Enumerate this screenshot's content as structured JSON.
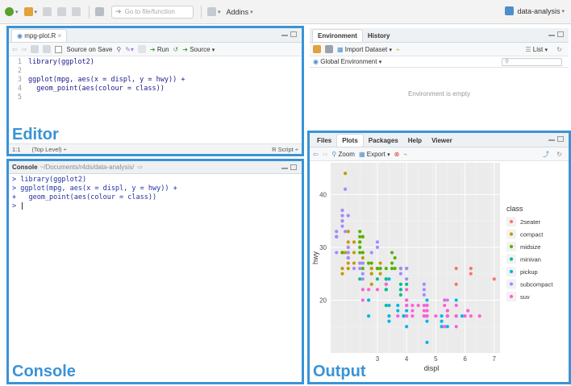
{
  "topbar": {
    "goto_placeholder": "Go to file/function",
    "addins_label": "Addins",
    "project_label": "data-analysis"
  },
  "editor": {
    "tab_label": "mpg-plot.R",
    "source_on_save": "Source on Save",
    "run_label": "Run",
    "source_label": "Source",
    "lines": [
      {
        "n": "1",
        "text": "library(ggplot2)"
      },
      {
        "n": "2",
        "text": ""
      },
      {
        "n": "3",
        "text": "ggplot(mpg, aes(x = displ, y = hwy)) +"
      },
      {
        "n": "4",
        "text": "  geom_point(aes(colour = class))"
      },
      {
        "n": "5",
        "text": ""
      }
    ],
    "status_pos": "1:1",
    "status_scope": "(Top Level) ÷",
    "status_type": "R Script ÷",
    "big_label": "Editor"
  },
  "console": {
    "title": "Console",
    "path": "~/Documents/r4ds/data-analysis/",
    "lines": [
      "> library(ggplot2)",
      "> ggplot(mpg, aes(x = displ, y = hwy)) +",
      "+   geom_point(aes(colour = class))",
      "> "
    ],
    "big_label": "Console"
  },
  "environment": {
    "tabs": [
      "Environment",
      "History"
    ],
    "import_label": "Import Dataset",
    "list_label": "List",
    "scope_label": "Global Environment",
    "empty_text": "Environment is empty"
  },
  "output": {
    "tabs": [
      "Files",
      "Plots",
      "Packages",
      "Help",
      "Viewer"
    ],
    "active_tab": "Plots",
    "zoom_label": "Zoom",
    "export_label": "Export",
    "big_label": "Output"
  },
  "colors": {
    "accent": "#3a93d6",
    "2seater": "#f8766d",
    "compact": "#c49a00",
    "midsize": "#53b400",
    "minivan": "#00c094",
    "pickup": "#00b6eb",
    "subcompact": "#a58aff",
    "suv": "#fb61d7"
  },
  "chart_data": {
    "type": "scatter",
    "title": "",
    "xlabel": "displ",
    "ylabel": "hwy",
    "xlim": [
      1.4,
      7.2
    ],
    "ylim": [
      10,
      46
    ],
    "x_ticks": [
      3,
      4,
      5,
      6,
      7
    ],
    "y_ticks": [
      20,
      30,
      40
    ],
    "grid": true,
    "legend_title": "class",
    "legend_position": "right",
    "series": [
      {
        "name": "2seater",
        "points": [
          [
            5.7,
            26
          ],
          [
            5.7,
            23
          ],
          [
            6.2,
            26
          ],
          [
            6.2,
            25
          ],
          [
            7.0,
            24
          ]
        ]
      },
      {
        "name": "compact",
        "points": [
          [
            1.8,
            29
          ],
          [
            1.8,
            29
          ],
          [
            2.0,
            31
          ],
          [
            2.0,
            30
          ],
          [
            2.8,
            26
          ],
          [
            2.8,
            26
          ],
          [
            3.1,
            27
          ],
          [
            1.8,
            26
          ],
          [
            1.8,
            25
          ],
          [
            2.0,
            28
          ],
          [
            2.0,
            27
          ],
          [
            2.8,
            25
          ],
          [
            2.8,
            25
          ],
          [
            3.1,
            25
          ],
          [
            2.2,
            27
          ],
          [
            2.2,
            29
          ],
          [
            2.4,
            31
          ],
          [
            2.4,
            31
          ],
          [
            3.0,
            26
          ],
          [
            1.8,
            37
          ],
          [
            1.8,
            35
          ],
          [
            1.8,
            29
          ],
          [
            2.0,
            29
          ],
          [
            2.5,
            28
          ],
          [
            2.5,
            29
          ],
          [
            1.9,
            44
          ],
          [
            1.9,
            29
          ],
          [
            2.0,
            26
          ],
          [
            2.8,
            23
          ],
          [
            2.5,
            32
          ],
          [
            2.5,
            27
          ],
          [
            2.0,
            33
          ],
          [
            2.7,
            27
          ],
          [
            2.2,
            31
          ]
        ]
      },
      {
        "name": "midsize",
        "points": [
          [
            2.4,
            27
          ],
          [
            2.4,
            30
          ],
          [
            3.1,
            26
          ],
          [
            3.5,
            29
          ],
          [
            3.6,
            26
          ],
          [
            2.4,
            33
          ],
          [
            3.0,
            26
          ],
          [
            3.3,
            24
          ],
          [
            3.8,
            26
          ],
          [
            3.8,
            26
          ],
          [
            4.0,
            26
          ],
          [
            2.5,
            27
          ],
          [
            2.5,
            26
          ],
          [
            3.0,
            26
          ],
          [
            3.5,
            26
          ],
          [
            3.3,
            22
          ],
          [
            3.3,
            24
          ],
          [
            2.4,
            32
          ],
          [
            2.4,
            29
          ],
          [
            3.1,
            26
          ],
          [
            3.3,
            26
          ],
          [
            2.7,
            27
          ],
          [
            2.5,
            29
          ],
          [
            2.4,
            31
          ],
          [
            3.5,
            27
          ],
          [
            1.8,
            29
          ],
          [
            2.0,
            28
          ],
          [
            2.8,
            27
          ],
          [
            3.6,
            28
          ],
          [
            2.5,
            32
          ]
        ]
      },
      {
        "name": "minivan",
        "points": [
          [
            2.4,
            24
          ],
          [
            3.0,
            24
          ],
          [
            3.3,
            22
          ],
          [
            3.3,
            19
          ],
          [
            3.3,
            22
          ],
          [
            3.8,
            22
          ],
          [
            3.8,
            21
          ],
          [
            3.8,
            23
          ],
          [
            4.0,
            23
          ],
          [
            3.3,
            24
          ],
          [
            3.8,
            22
          ]
        ]
      },
      {
        "name": "pickup",
        "points": [
          [
            3.7,
            19
          ],
          [
            3.7,
            18
          ],
          [
            3.9,
            17
          ],
          [
            3.9,
            17
          ],
          [
            4.7,
            19
          ],
          [
            4.7,
            19
          ],
          [
            4.7,
            12
          ],
          [
            5.2,
            17
          ],
          [
            5.2,
            15
          ],
          [
            5.7,
            17
          ],
          [
            5.9,
            17
          ],
          [
            4.7,
            17
          ],
          [
            5.2,
            16
          ],
          [
            4.6,
            17
          ],
          [
            4.6,
            17
          ],
          [
            5.4,
            17
          ],
          [
            5.4,
            15
          ],
          [
            5.4,
            17
          ],
          [
            2.7,
            20
          ],
          [
            2.7,
            20
          ],
          [
            2.7,
            17
          ],
          [
            3.4,
            19
          ],
          [
            3.4,
            17
          ],
          [
            4.0,
            17
          ],
          [
            4.0,
            18
          ],
          [
            4.0,
            20
          ],
          [
            4.7,
            20
          ],
          [
            4.7,
            17
          ],
          [
            4.7,
            16
          ],
          [
            5.7,
            20
          ],
          [
            3.4,
            24
          ],
          [
            3.4,
            16
          ],
          [
            4.0,
            15
          ]
        ]
      },
      {
        "name": "subcompact",
        "points": [
          [
            1.6,
            33
          ],
          [
            1.6,
            32
          ],
          [
            1.6,
            32
          ],
          [
            1.6,
            29
          ],
          [
            1.6,
            32
          ],
          [
            1.8,
            34
          ],
          [
            1.8,
            36
          ],
          [
            1.8,
            36
          ],
          [
            2.0,
            29
          ],
          [
            2.4,
            26
          ],
          [
            2.4,
            27
          ],
          [
            3.0,
            30
          ],
          [
            3.0,
            31
          ],
          [
            3.8,
            26
          ],
          [
            3.8,
            25
          ],
          [
            4.0,
            26
          ],
          [
            4.0,
            24
          ],
          [
            4.6,
            21
          ],
          [
            4.6,
            22
          ],
          [
            4.6,
            23
          ],
          [
            5.4,
            20
          ],
          [
            1.8,
            35
          ],
          [
            1.8,
            37
          ],
          [
            2.0,
            36
          ],
          [
            2.0,
            28
          ],
          [
            2.5,
            25
          ],
          [
            2.5,
            27
          ],
          [
            2.0,
            30
          ],
          [
            2.5,
            24
          ],
          [
            2.2,
            26
          ],
          [
            1.9,
            41
          ],
          [
            2.0,
            29
          ],
          [
            1.9,
            33
          ],
          [
            2.0,
            36
          ],
          [
            2.8,
            29
          ]
        ]
      },
      {
        "name": "suv",
        "points": [
          [
            5.3,
            20
          ],
          [
            5.3,
            15
          ],
          [
            5.3,
            20
          ],
          [
            5.7,
            17
          ],
          [
            6.0,
            17
          ],
          [
            6.5,
            17
          ],
          [
            3.0,
            22
          ],
          [
            3.7,
            17
          ],
          [
            4.0,
            19
          ],
          [
            4.7,
            19
          ],
          [
            4.7,
            17
          ],
          [
            4.7,
            17
          ],
          [
            4.7,
            17
          ],
          [
            5.7,
            15
          ],
          [
            6.1,
            18
          ],
          [
            4.0,
            20
          ],
          [
            4.2,
            17
          ],
          [
            4.4,
            19
          ],
          [
            4.6,
            17
          ],
          [
            4.6,
            17
          ],
          [
            4.6,
            19
          ],
          [
            5.4,
            17
          ],
          [
            5.4,
            18
          ],
          [
            5.4,
            18
          ],
          [
            5.4,
            17
          ],
          [
            4.0,
            19
          ],
          [
            4.0,
            17
          ],
          [
            4.6,
            18
          ],
          [
            5.0,
            17
          ],
          [
            4.2,
            18
          ],
          [
            4.2,
            19
          ],
          [
            4.7,
            18
          ],
          [
            5.7,
            19
          ],
          [
            2.5,
            22
          ],
          [
            2.5,
            20
          ],
          [
            2.7,
            22
          ],
          [
            4.0,
            20
          ],
          [
            4.0,
            22
          ],
          [
            3.3,
            23
          ],
          [
            3.3,
            23
          ],
          [
            4.7,
            17
          ],
          [
            5.7,
            17
          ],
          [
            6.1,
            18
          ],
          [
            5.3,
            19
          ],
          [
            6.2,
            17
          ],
          [
            4.0,
            19
          ],
          [
            4.7,
            18
          ]
        ]
      }
    ]
  }
}
